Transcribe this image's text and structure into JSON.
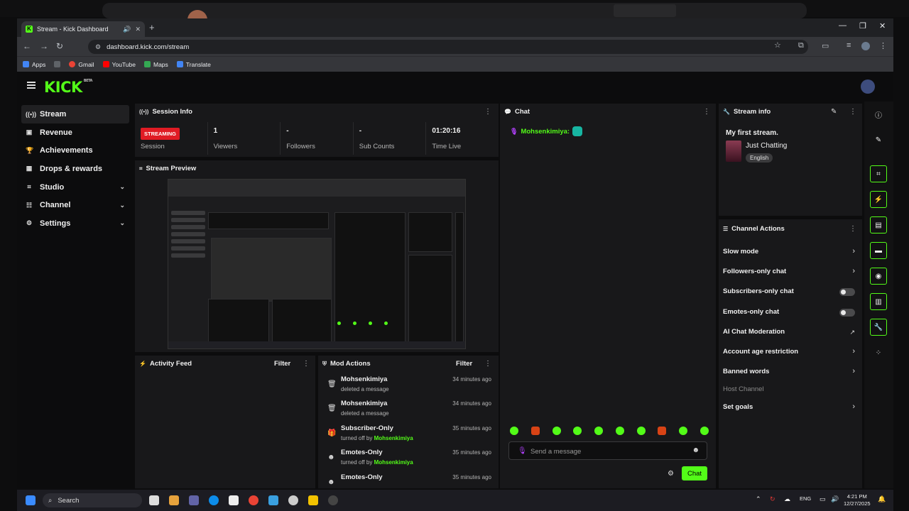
{
  "browser": {
    "tab_title": "Stream - Kick Dashboard",
    "tab_favicon": "K",
    "url": "dashboard.kick.com/stream",
    "bookmarks": [
      {
        "label": "Apps",
        "color": "#4285f4"
      },
      {
        "label": "",
        "color": "#5f6368"
      },
      {
        "label": "Gmail",
        "color": "#ea4335"
      },
      {
        "label": "YouTube",
        "color": "#ff0000"
      },
      {
        "label": "Maps",
        "color": "#34a853"
      },
      {
        "label": "Translate",
        "color": "#4285f4"
      }
    ]
  },
  "app": {
    "logo": "KICK",
    "logo_tag": "BETA",
    "accent": "#53fc18"
  },
  "sidebar": {
    "items": [
      {
        "label": "Stream",
        "icon": "broadcast-icon"
      },
      {
        "label": "Revenue",
        "icon": "revenue-icon"
      },
      {
        "label": "Achievements",
        "icon": "trophy-icon"
      },
      {
        "label": "Drops & rewards",
        "icon": "gift-icon"
      },
      {
        "label": "Studio",
        "icon": "studio-icon"
      },
      {
        "label": "Channel",
        "icon": "channel-icon"
      },
      {
        "label": "Settings",
        "icon": "gear-icon"
      }
    ]
  },
  "session": {
    "title": "Session Info",
    "status": "STREAMING",
    "status_label": "Session",
    "stats": [
      {
        "value": "1",
        "label": "Viewers"
      },
      {
        "value": "-",
        "label": "Followers"
      },
      {
        "value": "-",
        "label": "Sub Counts"
      },
      {
        "value": "01:20:16",
        "label": "Time Live"
      }
    ]
  },
  "preview": {
    "title": "Stream Preview"
  },
  "activity": {
    "title": "Activity Feed",
    "filter": "Filter"
  },
  "mod": {
    "title": "Mod Actions",
    "filter": "Filter",
    "rows": [
      {
        "name": "Mohsenkimiya",
        "text": "deleted a message",
        "by": "",
        "time": "34 minutes ago",
        "icon": "trash-icon"
      },
      {
        "name": "Mohsenkimiya",
        "text": "deleted a message",
        "by": "",
        "time": "34 minutes ago",
        "icon": "trash-icon"
      },
      {
        "name": "Subscriber-Only",
        "text": "turned off by",
        "by": "Mohsenkimiya",
        "time": "35 minutes ago",
        "icon": "gift-icon"
      },
      {
        "name": "Emotes-Only",
        "text": "turned off by",
        "by": "Mohsenkimiya",
        "time": "35 minutes ago",
        "icon": "smile-icon"
      },
      {
        "name": "Emotes-Only",
        "text": "",
        "by": "",
        "time": "35 minutes ago",
        "icon": "smile-icon"
      }
    ]
  },
  "chat": {
    "title": "Chat",
    "message_user": "Mohsenkimiya:",
    "placeholder": "Send a message",
    "send_label": "Chat"
  },
  "stream_info": {
    "title": "Stream info",
    "stream_title": "My first stream.",
    "category": "Just Chatting",
    "language": "English"
  },
  "channel_actions": {
    "title": "Channel Actions",
    "items": [
      {
        "label": "Slow mode",
        "control": "chevron"
      },
      {
        "label": "Followers-only chat",
        "control": "chevron"
      },
      {
        "label": "Subscribers-only chat",
        "control": "toggle"
      },
      {
        "label": "Emotes-only chat",
        "control": "toggle"
      },
      {
        "label": "AI Chat Moderation",
        "control": "external"
      },
      {
        "label": "Account age restriction",
        "control": "chevron"
      },
      {
        "label": "Banned words",
        "control": "chevron"
      },
      {
        "label": "Host Channel",
        "control": "none"
      },
      {
        "label": "Set goals",
        "control": "chevron"
      }
    ]
  },
  "taskbar": {
    "search_label": "Search",
    "lang": "ENG",
    "time": "4:21 PM",
    "date": "12/27/2025"
  }
}
